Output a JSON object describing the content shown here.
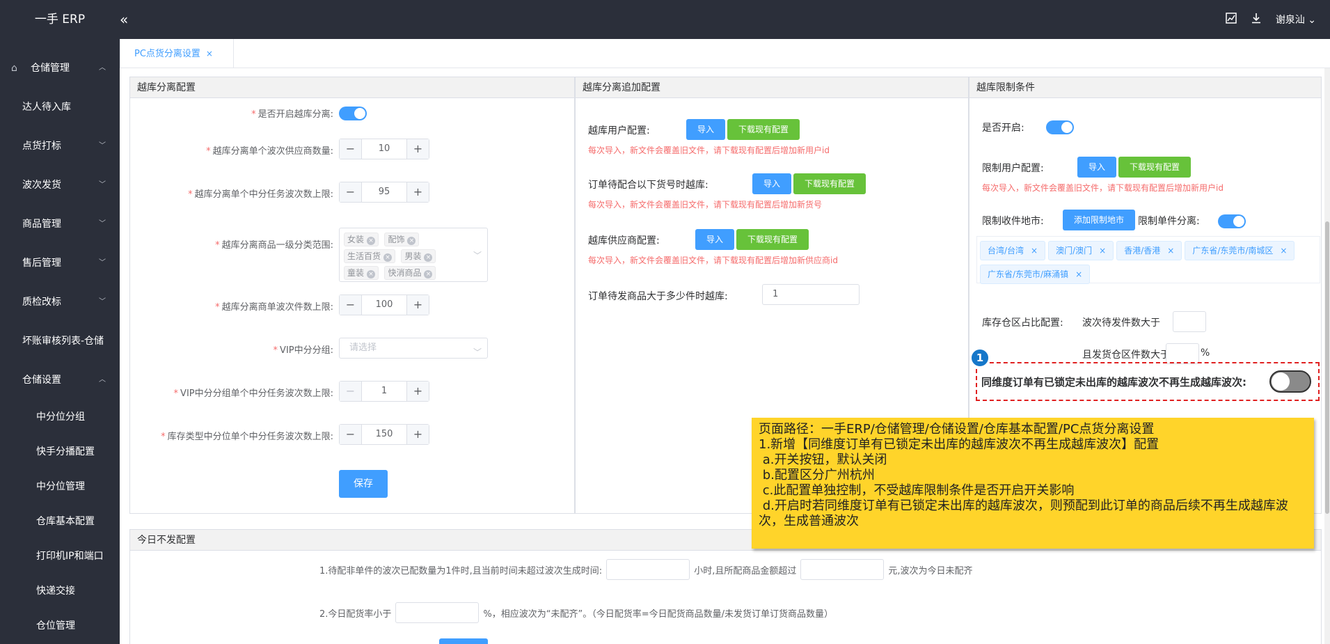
{
  "app": {
    "title": "一手 ERP",
    "user": "谢泉汕"
  },
  "topbar": {
    "collapse_icon": "«",
    "chart_icon": "chart-icon",
    "download_icon": "download-icon"
  },
  "sidebar": {
    "items": [
      {
        "label": "仓储管理"
      },
      {
        "label": "达人待入库"
      },
      {
        "label": "点货打标"
      },
      {
        "label": "波次发货"
      },
      {
        "label": "商品管理"
      },
      {
        "label": "售后管理"
      },
      {
        "label": "质检改标"
      },
      {
        "label": "坏账审核列表-仓储"
      },
      {
        "label": "仓储设置"
      },
      {
        "label": "中分位分组"
      },
      {
        "label": "快手分播配置"
      },
      {
        "label": "中分位管理"
      },
      {
        "label": "仓库基本配置"
      },
      {
        "label": "打印机IP和端口"
      },
      {
        "label": "快递交接"
      },
      {
        "label": "仓位管理"
      }
    ]
  },
  "tabs": [
    {
      "label": "PC点货分离设置",
      "close": "×"
    }
  ],
  "panel1": {
    "title": "越库分离配置",
    "enable_label": "是否开启越库分离:",
    "supplier_label": "越库分离单个波次供应商数量:",
    "supplier_value": "10",
    "wave_limit_label": "越库分离单个中分任务波次数上限:",
    "wave_limit_value": "95",
    "category_label": "越库分离商品一级分类范围:",
    "categories": [
      "女装",
      "配饰",
      "生活百货",
      "男装",
      "童装",
      "快消商品"
    ],
    "piece_limit_label": "越库分离商单波次件数上限:",
    "piece_limit_value": "100",
    "vip_group_label": "VIP中分分组:",
    "vip_group_placeholder": "请选择",
    "vip_wave_label": "VIP中分分组单个中分任务波次数上限:",
    "vip_wave_value": "1",
    "storage_wave_label": "库存类型中分位单个中分任务波次数上限:",
    "storage_wave_value": "150",
    "save": "保存",
    "minus": "−",
    "plus": "+"
  },
  "panel2": {
    "title": "越库分离追加配置",
    "user_cfg_label": "越库用户配置:",
    "goods_cfg_label": "订单待配合以下货号时越库:",
    "supplier_cfg_label": "越库供应商配置:",
    "import": "导入",
    "download": "下载现有配置",
    "hint_user": "每次导入，新文件会覆盖旧文件，请下载现有配置后增加新用户id",
    "hint_goods": "每次导入，新文件会覆盖旧文件，请下载现有配置后增加新货号",
    "hint_supplier": "每次导入，新文件会覆盖旧文件，请下载现有配置后增加新供应商id",
    "pending_label": "订单待发商品大于多少件时越库:",
    "pending_value": "1"
  },
  "panel3": {
    "title": "越库限制条件",
    "enable_label": "是否开启:",
    "user_limit_label": "限制用户配置:",
    "import": "导入",
    "download": "下载现有配置",
    "hint_user": "每次导入，新文件会覆盖旧文件，请下载现有配置后增加新用户id",
    "city_label": "限制收件地市:",
    "add_city": "添加限制地市",
    "single_label": "限制单件分离:",
    "cities": [
      "台湾/台湾",
      "澳门/澳门",
      "香港/香港",
      "广东省/东莞市/南城区",
      "广东省/东莞市/麻涌镇"
    ],
    "ratio_label": "库存仓区占比配置:",
    "wave_pending_label": "波次待发件数大于",
    "ship_area_label": "且发货仓区件数大于",
    "percent": "%",
    "locked_label": "同维度订单有已锁定未出库的越库波次不再生成越库波次:"
  },
  "panel4": {
    "title": "今日不发配置",
    "rule1_a": "1.待配非单件的波次已配数量为1件时,且当前时间未超过波次生成时间:",
    "rule1_b": "小时,且所配商品金额超过",
    "rule1_c": "元,波次为今日未配齐",
    "rule2_a": "2.今日配货率小于",
    "rule2_b": "%，相应波次为“未配齐”。（今日配货率=今日配货商品数量/未发货订单订货商品数量）"
  },
  "annotation": {
    "badge": "1",
    "lines": [
      "页面路径：一手ERP/仓储管理/仓储设置/仓库基本配置/PC点货分离设置",
      "1.新增【同维度订单有已锁定未出库的越库波次不再生成越库波次】配置",
      " a.开关按钮，默认关闭",
      " b.配置区分广州杭州",
      " c.此配置单独控制，不受越库限制条件是否开启开关影响",
      " d.开启时若同维度订单有已锁定未出库的越库波次，则预配到此订单的商品后续不再生成越库波次，生成普通波次"
    ]
  },
  "colors": {
    "sidebar_bg": "#2b2f3a",
    "primary": "#409eff",
    "success": "#67c23a",
    "danger": "#f56c6c",
    "note_bg": "#ffd42a"
  }
}
